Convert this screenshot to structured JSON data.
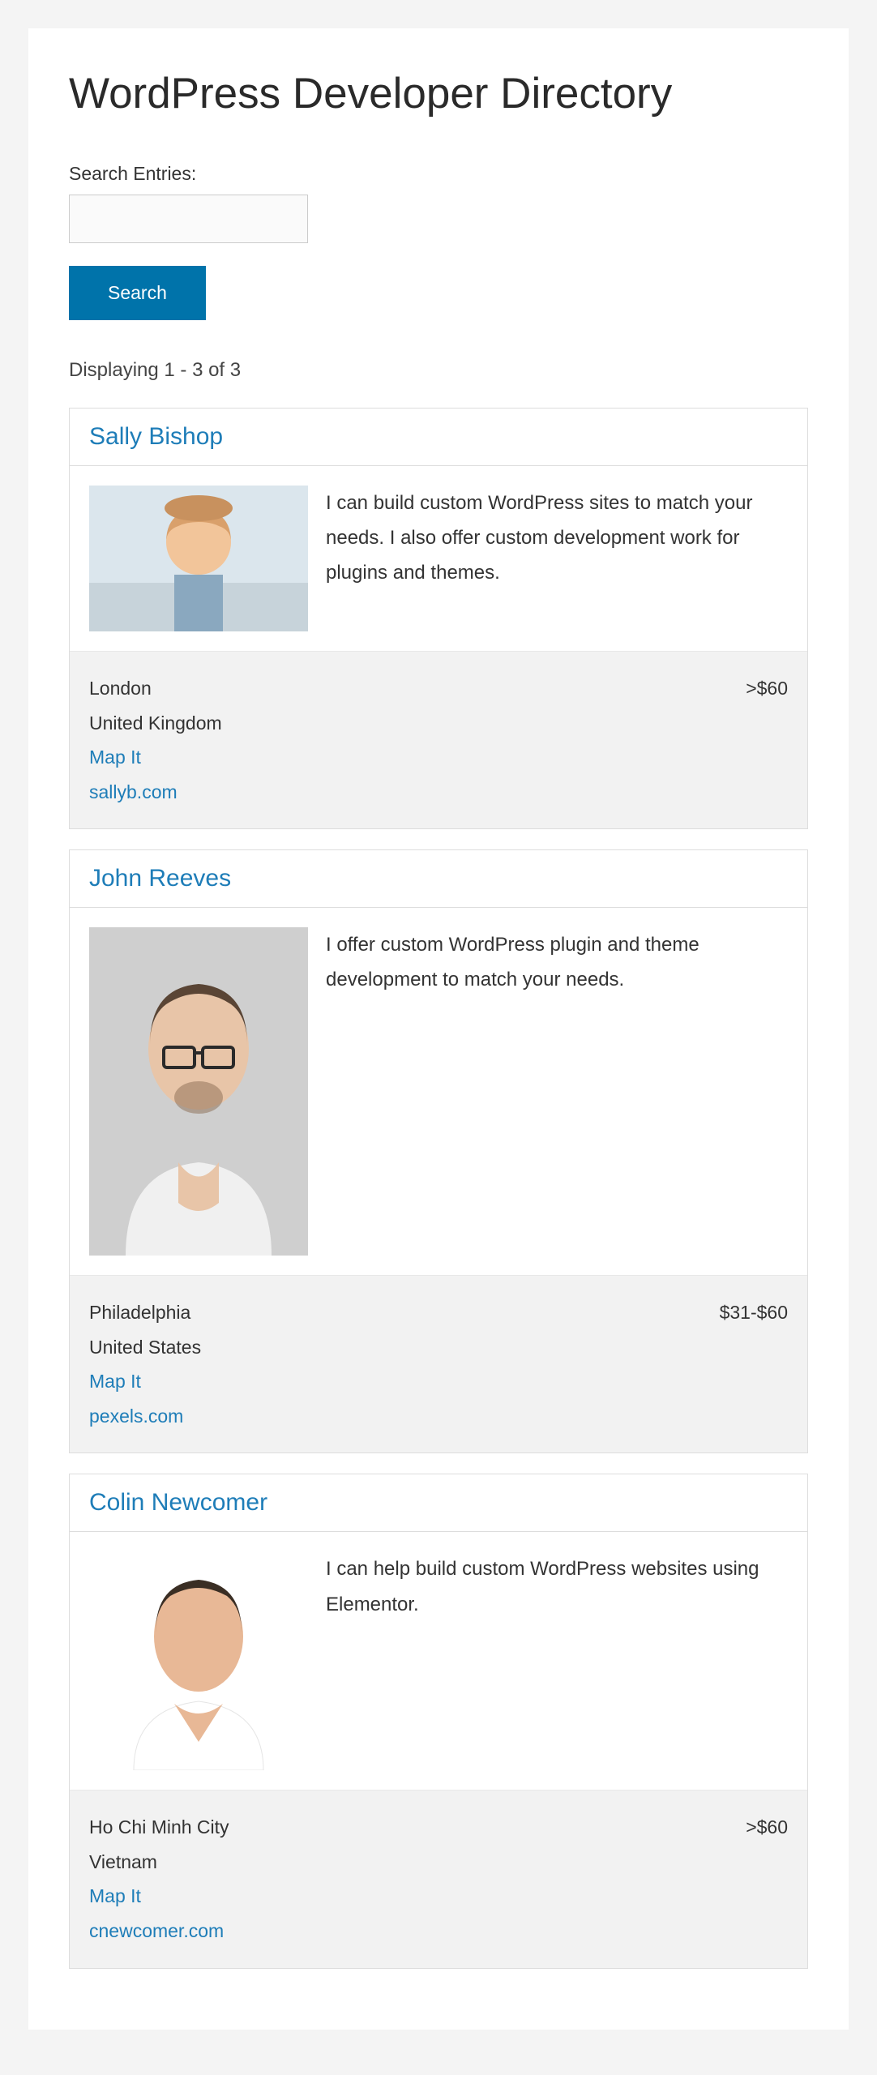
{
  "page": {
    "title": "WordPress Developer Directory",
    "search_label": "Search Entries:",
    "search_button": "Search",
    "results_text": "Displaying 1 - 3 of 3"
  },
  "entries": [
    {
      "name": "Sally Bishop",
      "description": "I can build custom WordPress sites to match your needs. I also offer custom development work for plugins and themes.",
      "city": "London",
      "country": "United Kingdom",
      "map_label": "Map It",
      "website": "sallyb.com",
      "price": ">$60"
    },
    {
      "name": "John Reeves",
      "description": "I offer custom WordPress plugin and theme development to match your needs.",
      "city": "Philadelphia",
      "country": "United States",
      "map_label": "Map It",
      "website": "pexels.com",
      "price": "$31-$60"
    },
    {
      "name": "Colin Newcomer",
      "description": "I can help build custom WordPress websites using Elementor.",
      "city": "Ho Chi Minh City",
      "country": "Vietnam",
      "map_label": "Map It",
      "website": "cnewcomer.com",
      "price": ">$60"
    }
  ]
}
